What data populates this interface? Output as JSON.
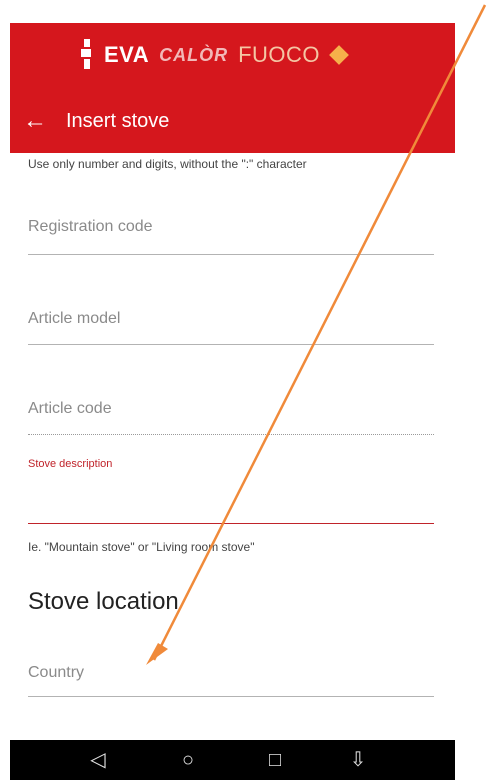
{
  "header": {
    "logo": {
      "brand1": "EVA",
      "brand2": "CALÒR",
      "brand3": "FUOCO"
    },
    "title": "Insert stove",
    "back_icon": "arrow-left-icon"
  },
  "form": {
    "top_hint": "Use only number and digits, without the \":\" character",
    "registration_placeholder": "Registration code",
    "article_model_placeholder": "Article model",
    "article_code_placeholder": "Article code",
    "stove_description_label": "Stove description",
    "stove_description_value": "",
    "stove_description_hint": "Ie. \"Mountain stove\" or \"Living room stove\"",
    "section_title": "Stove location",
    "country_placeholder": "Country"
  },
  "navbar": {
    "back_icon": "triangle-back-icon",
    "home_icon": "circle-home-icon",
    "recents_icon": "square-recents-icon",
    "menu_icon": "download-menu-icon"
  },
  "colors": {
    "header": "#d5171d",
    "accent_red": "#c0232a",
    "arrow": "#f08a3a"
  }
}
